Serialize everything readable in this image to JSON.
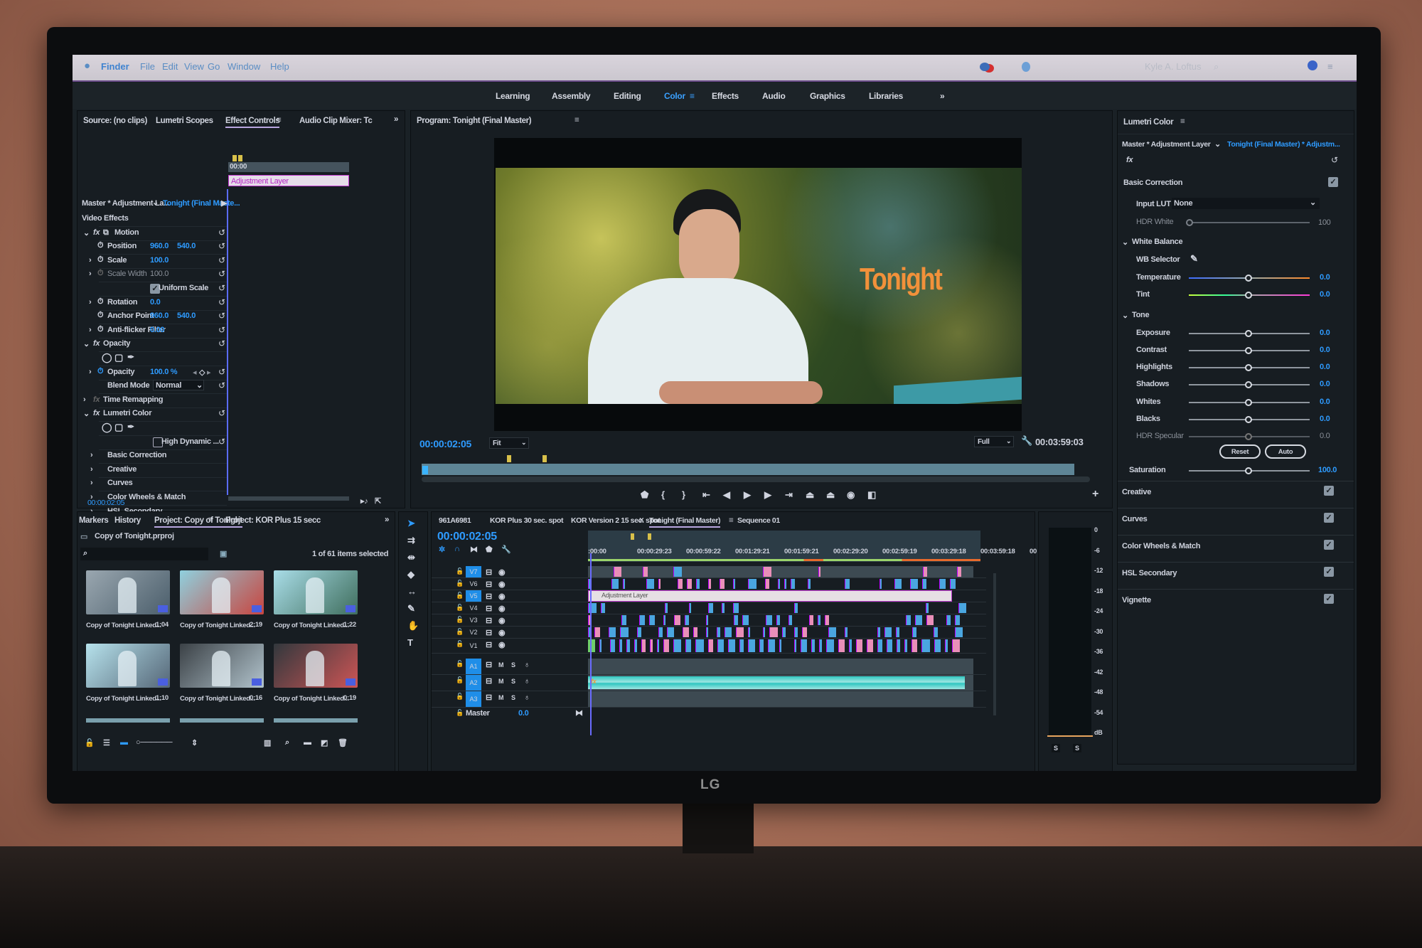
{
  "menubar": {
    "apple": "apple-icon",
    "items": [
      "Finder",
      "File",
      "Edit",
      "View",
      "Go",
      "Window",
      "Help"
    ],
    "user": "Kyle A. Loftus"
  },
  "workspaces": {
    "items": [
      "Learning",
      "Assembly",
      "Editing",
      "Color",
      "Effects",
      "Audio",
      "Graphics",
      "Libraries"
    ],
    "active": "Color",
    "more": "»"
  },
  "effect_panel": {
    "tabs": [
      "Source: (no clips)",
      "Lumetri Scopes",
      "Effect Controls",
      "Audio Clip Mixer: Tc"
    ],
    "active_tab": "Effect Controls",
    "master": "Master * Adjustment La...",
    "clip": "Tonight (Final Maste...",
    "mini_timecode": "00:00",
    "clip_bar": "Adjustment Layer",
    "rows": [
      {
        "label": "Video Effects",
        "kind": "header"
      },
      {
        "label": "Motion",
        "kind": "fx"
      },
      {
        "label": "Position",
        "v1": "960.0",
        "v2": "540.0",
        "kind": "prop"
      },
      {
        "label": "Scale",
        "v1": "100.0",
        "kind": "prop"
      },
      {
        "label": "Scale Width",
        "v1": "100.0",
        "kind": "prop-dim"
      },
      {
        "label": "Uniform Scale",
        "kind": "check"
      },
      {
        "label": "Rotation",
        "v1": "0.0",
        "kind": "prop"
      },
      {
        "label": "Anchor Point",
        "v1": "960.0",
        "v2": "540.0",
        "kind": "prop"
      },
      {
        "label": "Anti-flicker Filter",
        "v1": "0.00",
        "kind": "prop"
      },
      {
        "label": "Opacity",
        "kind": "fx"
      },
      {
        "label": "",
        "kind": "masks"
      },
      {
        "label": "Opacity",
        "v1": "100.0 %",
        "kind": "prop"
      },
      {
        "label": "Blend Mode",
        "v1": "Normal",
        "kind": "select"
      },
      {
        "label": "Time Remapping",
        "kind": "fx-dim"
      },
      {
        "label": "Lumetri Color",
        "kind": "fx"
      },
      {
        "label": "",
        "kind": "masks"
      },
      {
        "label": "High Dynamic ...",
        "kind": "check-off"
      },
      {
        "label": "Basic Correction",
        "kind": "sub"
      },
      {
        "label": "Creative",
        "kind": "sub"
      },
      {
        "label": "Curves",
        "kind": "sub"
      },
      {
        "label": "Color Wheels & Match",
        "kind": "sub"
      },
      {
        "label": "HSL Secondary",
        "kind": "sub"
      },
      {
        "label": "Vignette",
        "kind": "sub"
      }
    ],
    "timecode": "00:00:02:05"
  },
  "program": {
    "title": "Program: Tonight (Final Master)",
    "overlay_text": "Tonight",
    "timecode": "00:00:02:05",
    "fit": "Fit",
    "quality": "Full",
    "duration": "00:03:59:03"
  },
  "lumetri": {
    "title": "Lumetri Color",
    "master": "Master * Adjustment Layer",
    "clip": "Tonight (Final Master) * Adjustm...",
    "fx": "fx",
    "basic": "Basic Correction",
    "input_lut_label": "Input LUT",
    "input_lut": "None",
    "hdr_white_label": "HDR White",
    "hdr_white": "100",
    "white_balance": "White Balance",
    "wb_selector": "WB Selector",
    "tone": "Tone",
    "sliders": [
      {
        "label": "Temperature",
        "value": "0.0",
        "level": 0.5
      },
      {
        "label": "Tint",
        "value": "0.0",
        "level": 0.5
      },
      {
        "label": "Exposure",
        "value": "0.0",
        "level": 0.5
      },
      {
        "label": "Contrast",
        "value": "0.0",
        "level": 0.5
      },
      {
        "label": "Highlights",
        "value": "0.0",
        "level": 0.5
      },
      {
        "label": "Shadows",
        "value": "0.0",
        "level": 0.5
      },
      {
        "label": "Whites",
        "value": "0.0",
        "level": 0.5
      },
      {
        "label": "Blacks",
        "value": "0.0",
        "level": 0.5
      },
      {
        "label": "HDR Specular",
        "value": "0.0",
        "level": 0.5
      },
      {
        "label": "Saturation",
        "value": "100.0",
        "level": 0.5
      }
    ],
    "reset": "Reset",
    "auto": "Auto",
    "sections": [
      "Creative",
      "Curves",
      "Color Wheels & Match",
      "HSL Secondary",
      "Vignette"
    ]
  },
  "project": {
    "tabs": [
      "Markers",
      "History",
      "Project: Copy of Tonight",
      "Project: KOR Plus 15 secc"
    ],
    "active_tab": "Project: Copy of Tonight",
    "file": "Copy of Tonight.prproj",
    "search_placeholder": "",
    "selection": "1 of 61 items selected",
    "items": [
      {
        "name": "Copy of Tonight Linked...",
        "duration": "1:04"
      },
      {
        "name": "Copy of Tonight Linked...",
        "duration": "2:19"
      },
      {
        "name": "Copy of Tonight Linked...",
        "duration": "1:22"
      },
      {
        "name": "Copy of Tonight Linked...",
        "duration": "1:10"
      },
      {
        "name": "Copy of Tonight Linked...",
        "duration": "0:16"
      },
      {
        "name": "Copy of Tonight Linked...",
        "duration": "0:19"
      }
    ]
  },
  "timeline": {
    "tabs": [
      "961A6981",
      "KOR Plus 30 sec. spot",
      "KOR Version 2 15 sec. spot",
      "Tonight (Final Master)",
      "Sequence 01"
    ],
    "active_tab": "Tonight (Final Master)",
    "timecode": "00:00:02:05",
    "ruler": [
      ":00:00",
      "00:00:29:23",
      "00:00:59:22",
      "00:01:29:21",
      "00:01:59:21",
      "00:02:29:20",
      "00:02:59:19",
      "00:03:29:18",
      "00:03:59:18",
      "00"
    ],
    "video_tracks": [
      "V7",
      "V6",
      "V5",
      "V4",
      "V3",
      "V2",
      "V1"
    ],
    "audio_tracks": [
      "A1",
      "A2",
      "A3"
    ],
    "source_v": "V1",
    "source_a": "A1",
    "adjustment_clip": "Adjustment Layer",
    "master_label": "Master",
    "master_value": "0.0",
    "mute": "M",
    "solo": "S"
  },
  "meter": {
    "scale": [
      "0",
      "-6",
      "-12",
      "-18",
      "-24",
      "-30",
      "-36",
      "-42",
      "-48",
      "-54",
      "dB"
    ],
    "solo": [
      "S",
      "S"
    ]
  },
  "monitor_brand": "LG",
  "colors": {
    "accent": "#2e9bff",
    "clip_blue": "#4aa6e0",
    "clip_pink": "#e98fb8",
    "audio": "#2fc6c0",
    "title": "#f2913a"
  }
}
